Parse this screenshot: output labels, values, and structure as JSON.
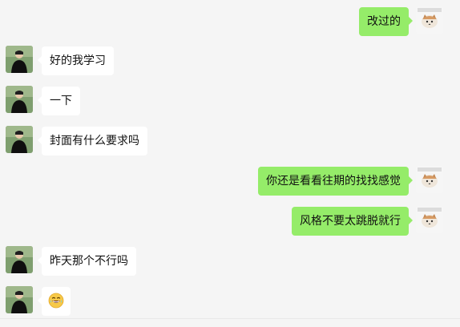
{
  "messages": [
    {
      "id": 1,
      "side": "right",
      "text": "改过的"
    },
    {
      "id": 2,
      "side": "left",
      "text": "好的我学习"
    },
    {
      "id": 3,
      "side": "left",
      "text": "一下"
    },
    {
      "id": 4,
      "side": "left",
      "text": "封面有什么要求吗"
    },
    {
      "id": 5,
      "side": "right",
      "text": "你还是看看往期的找找感觉"
    },
    {
      "id": 6,
      "side": "right",
      "text": "风格不要太跳脱就行"
    },
    {
      "id": 7,
      "side": "left",
      "text": "昨天那个不行吗"
    },
    {
      "id": 8,
      "side": "left",
      "emoji": "laughing-tears-emoji"
    }
  ],
  "colors": {
    "background": "#f5f5f5",
    "outgoing_bubble": "#95ec69",
    "incoming_bubble": "#ffffff"
  },
  "icons": {
    "left_avatar": "person-photo-avatar",
    "right_avatar": "cat-sticker-avatar",
    "emoji": "laughing-tears-emoji"
  }
}
